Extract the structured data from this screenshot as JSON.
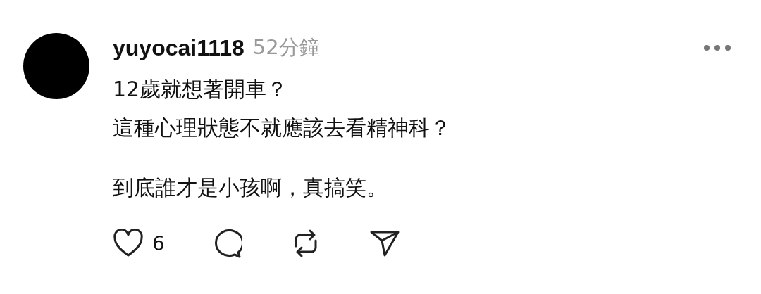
{
  "post": {
    "username": "yuyocai1118",
    "time": "52分鐘",
    "paragraphs": [
      [
        "12歲就想著開車？",
        "這種心理狀態不就應該去看精神科？"
      ],
      [
        "到底誰才是小孩啊，真搞笑。"
      ]
    ],
    "likes": "6",
    "liked": false
  }
}
